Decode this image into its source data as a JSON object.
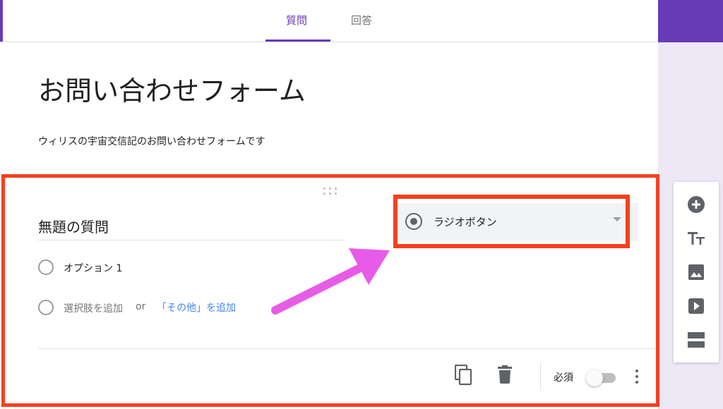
{
  "tabs": {
    "questions": "質問",
    "responses": "回答"
  },
  "form": {
    "title": "お問い合わせフォーム",
    "description": "ウィリスの宇宙交信記のお問い合わせフォームです"
  },
  "question": {
    "title": "無題の質問",
    "option1": "オプション 1",
    "add_option": "選択肢を追加",
    "or": "or",
    "add_other": "「その他」を追加",
    "type_label": "ラジオボタン",
    "required_label": "必須",
    "required": false
  },
  "colors": {
    "brand_purple": "#673ab7",
    "highlight_red": "#f4411f",
    "arrow_magenta": "#e85be8",
    "link_blue": "#4285f4"
  },
  "icons": {
    "copy": "copy-icon",
    "delete": "trash-icon",
    "more": "more-vert-icon",
    "add_question": "add-circle-icon",
    "add_title": "title-text-icon",
    "add_image": "image-icon",
    "add_video": "video-icon",
    "add_section": "section-icon"
  }
}
